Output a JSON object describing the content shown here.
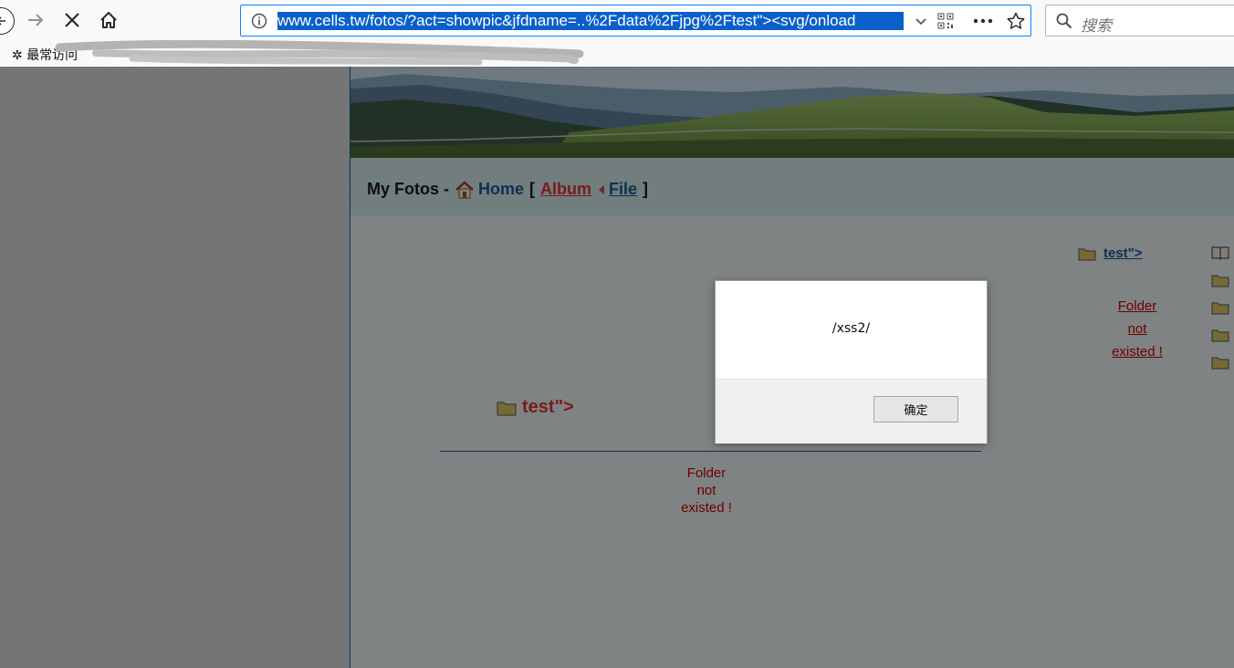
{
  "browser": {
    "url": "www.cells.tw/fotos/?act=showpic&jfdname=..%2Fdata%2Fjpg%2Ftest\"><svg/onload",
    "search_placeholder": "搜索",
    "bookmark_label": "最常访问",
    "icons": [
      "back-icon",
      "forward-icon",
      "stop-icon",
      "home-icon",
      "info-icon",
      "dropdown-icon",
      "qr-icon",
      "more-icon",
      "star-icon",
      "search-icon"
    ]
  },
  "page": {
    "title": "My Fotos -",
    "home_label": "Home",
    "bracket_open": "[",
    "album_label": "Album",
    "file_label": "File",
    "bracket_close": "]",
    "main_folder_label": "test\">",
    "main_message": [
      "Folder",
      "not",
      "existed !"
    ],
    "side_folder_label": "test\">",
    "side_message": [
      "Folder",
      "not",
      "existed !"
    ]
  },
  "dialog": {
    "message": "/xss2/",
    "ok_label": "确定"
  },
  "colors": {
    "accent": "#0a84ff",
    "link_blue": "#1a5a90",
    "link_red": "#dd3333",
    "error_red": "#cc0000"
  }
}
